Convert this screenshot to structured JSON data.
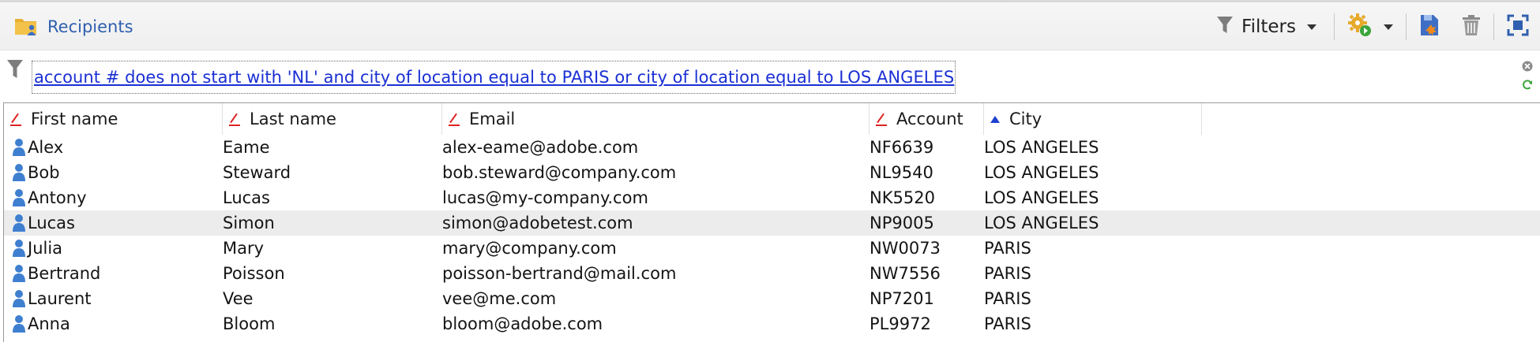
{
  "toolbar": {
    "title": "Recipients",
    "filters_label": "Filters"
  },
  "filter": {
    "condition": "account # does not start with 'NL' and city of location equal to PARIS or city of location equal to LOS ANGELES"
  },
  "table": {
    "columns": [
      "First name",
      "Last name",
      "Email",
      "Account",
      "City"
    ],
    "sorted_column": "City",
    "rows": [
      {
        "first": "Alex",
        "last": "Eame",
        "email": "alex-eame@adobe.com",
        "account": "NF6639",
        "city": "LOS ANGELES"
      },
      {
        "first": "Bob",
        "last": "Steward",
        "email": "bob.steward@company.com",
        "account": "NL9540",
        "city": "LOS ANGELES"
      },
      {
        "first": "Antony",
        "last": "Lucas",
        "email": "lucas@my-company.com",
        "account": "NK5520",
        "city": "LOS ANGELES"
      },
      {
        "first": "Lucas",
        "last": "Simon",
        "email": "simon@adobetest.com",
        "account": "NP9005",
        "city": "LOS ANGELES"
      },
      {
        "first": "Julia",
        "last": "Mary",
        "email": "mary@company.com",
        "account": "NW0073",
        "city": "PARIS"
      },
      {
        "first": "Bertrand",
        "last": "Poisson",
        "email": "poisson-bertrand@mail.com",
        "account": "NW7556",
        "city": "PARIS"
      },
      {
        "first": "Laurent",
        "last": "Vee",
        "email": "vee@me.com",
        "account": "NP7201",
        "city": "PARIS"
      },
      {
        "first": "Anna",
        "last": "Bloom",
        "email": "bloom@adobe.com",
        "account": "PL9972",
        "city": "PARIS"
      }
    ],
    "selected_row": 3
  },
  "colors": {
    "link": "#1a2fd4",
    "title": "#2f5fae",
    "person_icon": "#3f7fd0",
    "folder": "#e8b030",
    "sort_desc": "#dd2222",
    "sort_asc": "#1f3fcf"
  },
  "icons": [
    "folder-user-icon",
    "funnel-icon",
    "gear-add-icon",
    "save-icon",
    "trash-icon",
    "fullscreen-icon",
    "clear-filter-icon",
    "refresh-icon",
    "person-icon"
  ]
}
